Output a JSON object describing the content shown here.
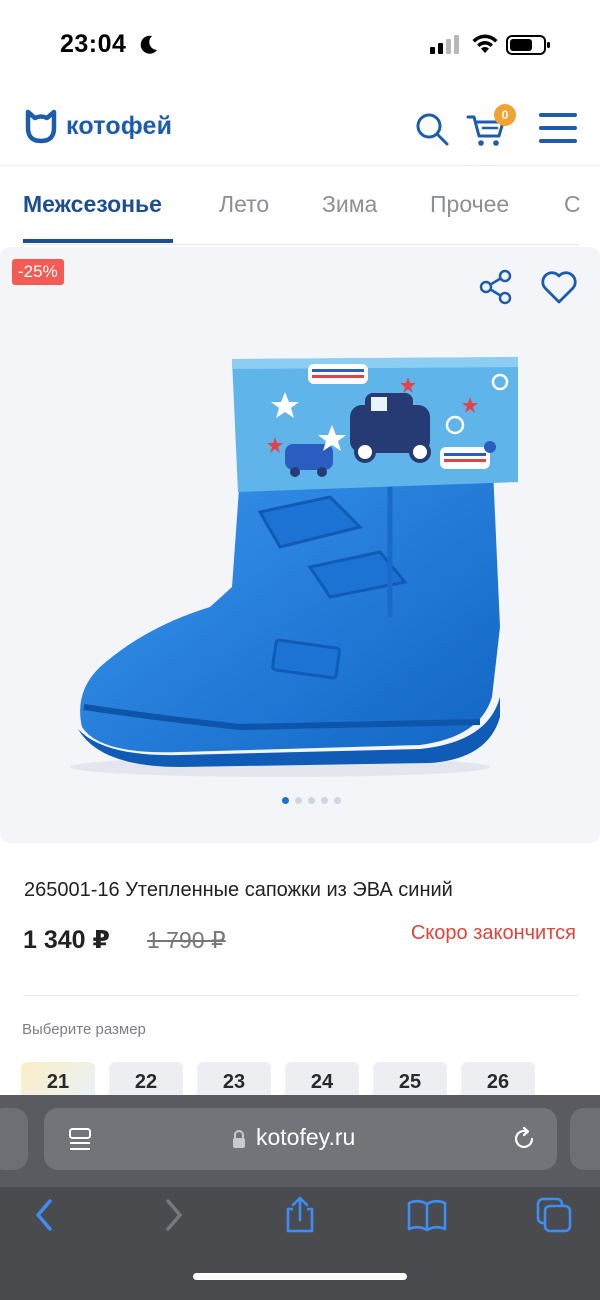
{
  "status_bar": {
    "time": "23:04"
  },
  "header": {
    "logo_text": "котофей",
    "cart_count": "0",
    "icons": [
      "logo-icon",
      "search-icon",
      "cart-icon",
      "menu-icon"
    ]
  },
  "tabs": [
    {
      "label": "Межсезонье",
      "active": true
    },
    {
      "label": "Лето",
      "active": false
    },
    {
      "label": "Зима",
      "active": false
    },
    {
      "label": "Прочее",
      "active": false
    },
    {
      "label": "С",
      "active": false
    }
  ],
  "gallery": {
    "discount": "-25%",
    "image_count": 5,
    "current_image": 1
  },
  "product": {
    "title": "265001-16 Утепленные сапожки из ЭВА синий",
    "price": "1 340 ₽",
    "old_price": "1 790 ₽",
    "stock_status": "Скоро закончится"
  },
  "size_selector": {
    "label": "Выберите размер",
    "sizes": [
      "21",
      "22",
      "23",
      "24",
      "25",
      "26"
    ]
  },
  "browser": {
    "url": "kotofey.ru"
  },
  "colors": {
    "brand": "#1d5cad",
    "accent_badge": "#f2a336",
    "discount": "#f25c54",
    "warning": "#e0443c",
    "ios_blue": "#3d8df5"
  }
}
